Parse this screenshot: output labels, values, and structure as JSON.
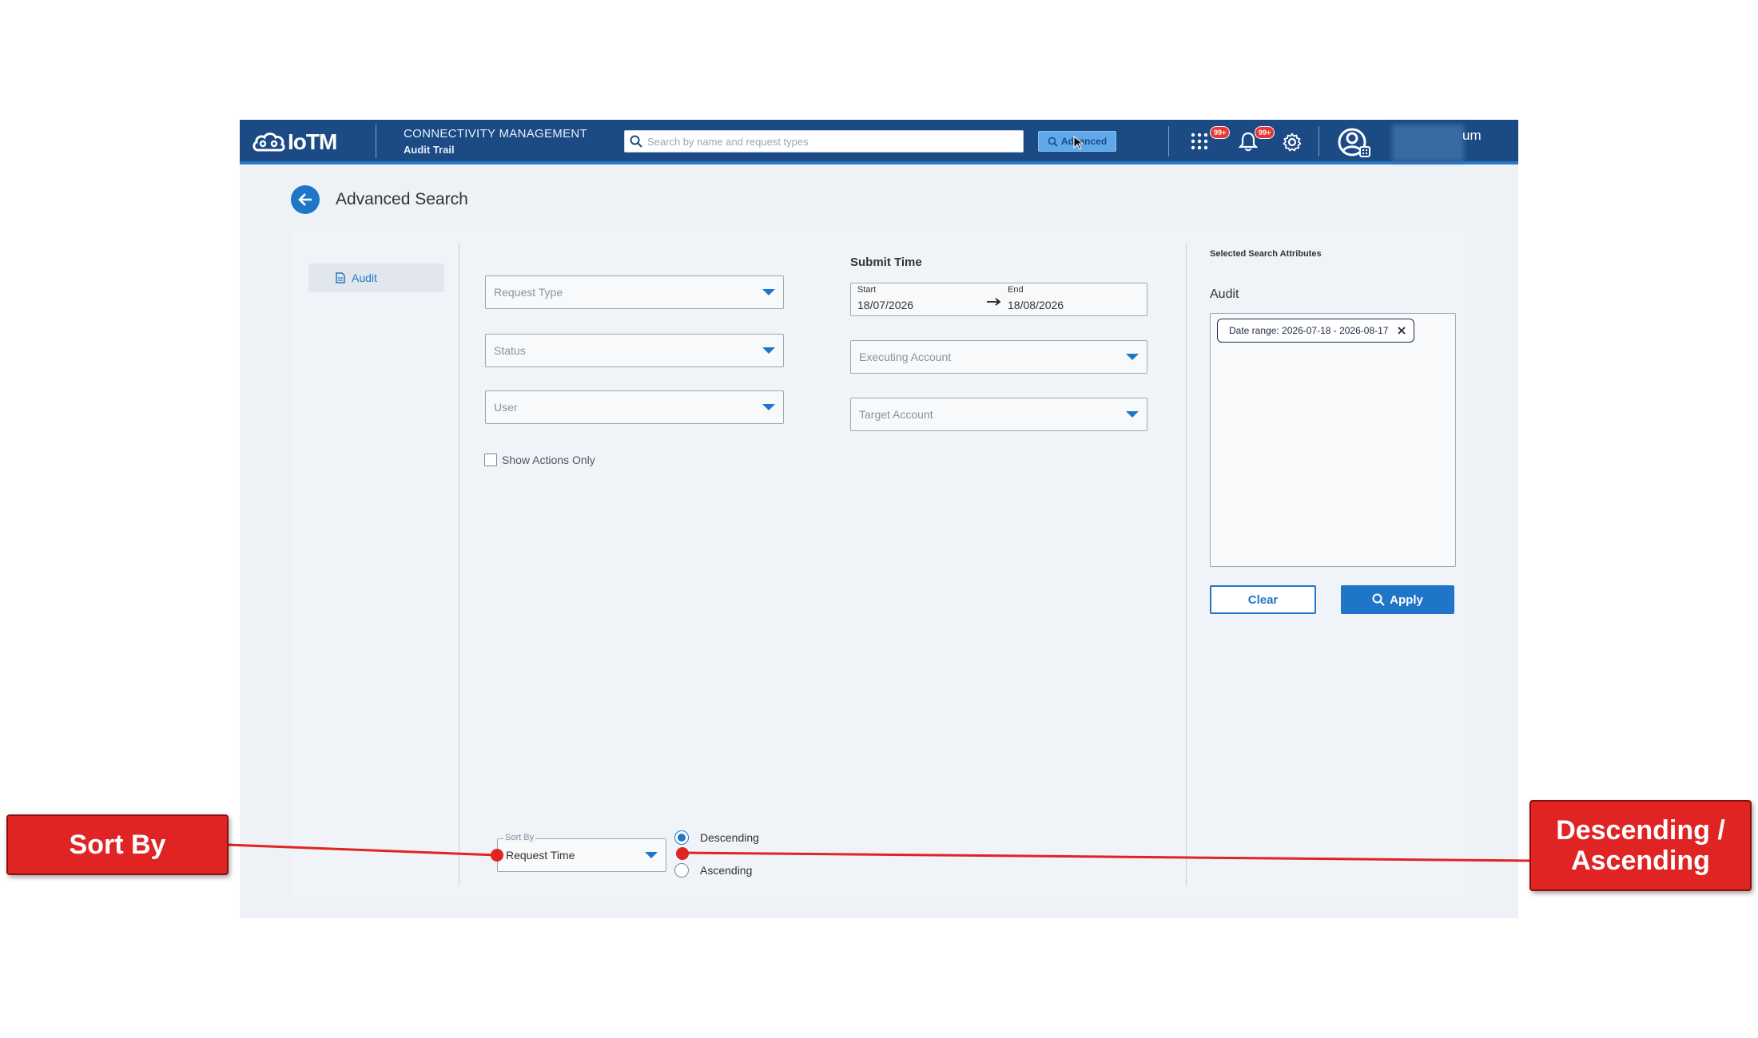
{
  "topbar": {
    "brand": "IoTM",
    "app_title": "CONNECTIVITY MANAGEMENT",
    "app_subtitle": "Audit Trail",
    "search_placeholder": "Search by name and request types",
    "advanced_label": "Advanced",
    "apps_badge": "99+",
    "notifications_badge": "99+",
    "user_name_fragment": "um",
    "icons": [
      "search-icon",
      "zoom-icon",
      "apps-grid-icon",
      "bell-icon",
      "gear-icon",
      "account-icon"
    ]
  },
  "page": {
    "title": "Advanced Search",
    "sidebar": {
      "items": [
        {
          "label": "Audit",
          "icon": "document-icon"
        }
      ]
    }
  },
  "filters": {
    "request_type": "Request Type",
    "status": "Status",
    "user": "User",
    "show_actions_only": "Show Actions Only",
    "submit_time": {
      "label": "Submit Time",
      "start_label": "Start",
      "start_value": "18/07/2026",
      "end_label": "End",
      "end_value": "18/08/2026"
    },
    "executing_account": "Executing Account",
    "target_account": "Target Account"
  },
  "attributes": {
    "title": "Selected Search Attributes",
    "section": "Audit",
    "chips": [
      {
        "label": "Date range: 2026-07-18 - 2026-08-17"
      }
    ]
  },
  "actions": {
    "clear": "Clear",
    "apply": "Apply"
  },
  "sort": {
    "legend": "Sort By",
    "value": "Request Time",
    "options": [
      {
        "label": "Descending",
        "selected": true
      },
      {
        "label": "Ascending",
        "selected": false
      }
    ]
  },
  "annotations": {
    "sort_by": "Sort By",
    "order_line1": "Descending /",
    "order_line2": "Ascending"
  },
  "colors": {
    "header": "#1b4a85",
    "accent": "#1f76c9",
    "annotation": "#e02424"
  }
}
